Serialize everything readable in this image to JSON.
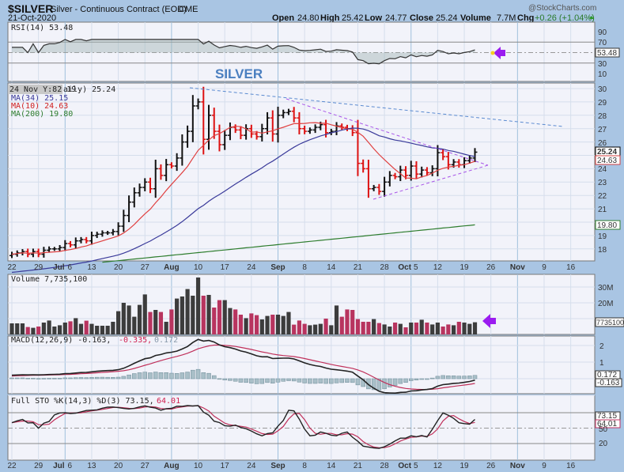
{
  "header": {
    "symbol": "$SILVER",
    "name": "Silver - Continuous Contract (EOD)",
    "exchange": "CME",
    "date": "21-Oct-2020",
    "watermark": "@StockCharts.com",
    "open_label": "Open",
    "open": "24.80",
    "high_label": "High",
    "high": "25.42",
    "low_label": "Low",
    "low": "24.77",
    "close_label": "Close",
    "close": "25.24",
    "volume_label": "Volume",
    "volume": "7.7M",
    "chg_label": "Chg",
    "chg": "+0.26 (+1.04%)"
  },
  "annotation": {
    "title": "SILVER"
  },
  "panels": {
    "rsi": {
      "legend": "RSI(14) 53.48",
      "value": "53.48",
      "ticks": [
        "90",
        "70",
        "30",
        "10"
      ]
    },
    "price": {
      "legend": "aily) 25.24",
      "tooltip": "24 Nov Y:82 19",
      "ma34": "MA(34) 25.15",
      "ma10": "MA(10) 24.63",
      "ma200": "MA(200) 19.80",
      "close_tag": "25.24",
      "ma10_tag": "24.63",
      "ma200_tag": "19.80",
      "ticks": [
        "30",
        "29",
        "28",
        "27",
        "26",
        "24",
        "23",
        "22",
        "21",
        "19",
        "18"
      ]
    },
    "volume": {
      "legend": "Volume 7,735,100",
      "tag": "7735100",
      "ticks": [
        "30M",
        "20M"
      ]
    },
    "macd": {
      "legend_name": "MACD(12,26,9) -0.163,",
      "legend_signal": "-0.335,",
      "legend_hist": "0.172",
      "hist_tag": "0.172",
      "macd_tag": "-0.163",
      "ticks": [
        "2",
        "1"
      ]
    },
    "sto": {
      "legend_name": "Full STO %K(14,3) %D(3) 73.15,",
      "legend_d": "64.01",
      "k_tag": "73.15",
      "d_tag": "64.01",
      "ticks": [
        "50",
        "20"
      ]
    }
  },
  "colors": {
    "up": "#111111",
    "down": "#dd1111",
    "ma10": "#e04040",
    "ma34": "#3a3a9a",
    "ma200": "#2e7d2e",
    "vol_up": "#3c3c3c",
    "vol_down": "#b8345f",
    "arrow": "#9b1cf0"
  },
  "date_labels": [
    {
      "i": 0,
      "text": "22"
    },
    {
      "i": 5,
      "text": "29"
    },
    {
      "i": 10,
      "text": "Jul",
      "sub": "6"
    },
    {
      "i": 15,
      "text": "13"
    },
    {
      "i": 20,
      "text": "20"
    },
    {
      "i": 25,
      "text": "27"
    },
    {
      "i": 30,
      "text": "Aug",
      "bold": true
    },
    {
      "i": 35,
      "text": "10"
    },
    {
      "i": 40,
      "text": "17"
    },
    {
      "i": 45,
      "text": "24"
    },
    {
      "i": 50,
      "text": "Sep",
      "bold": true
    },
    {
      "i": 55,
      "text": "8"
    },
    {
      "i": 60,
      "text": "14"
    },
    {
      "i": 65,
      "text": "21"
    },
    {
      "i": 70,
      "text": "28"
    },
    {
      "i": 75,
      "text": "Oct",
      "sub": "5"
    },
    {
      "i": 80,
      "text": "12"
    },
    {
      "i": 85,
      "text": "19"
    },
    {
      "i": 90,
      "text": "26"
    },
    {
      "i": 95,
      "text": "Nov",
      "bold": true
    },
    {
      "i": 100,
      "text": "9"
    },
    {
      "i": 105,
      "text": "16"
    }
  ],
  "chart_data": {
    "type": "ohlc",
    "title": "$SILVER Silver - Continuous Contract (EOD)",
    "x_start": "2020-06-22",
    "x_end": "2020-10-21",
    "closes": [
      17.6,
      17.7,
      17.8,
      17.6,
      17.8,
      17.6,
      17.9,
      18.0,
      18.0,
      18.1,
      18.4,
      18.3,
      18.6,
      18.7,
      18.6,
      19.0,
      19.1,
      19.2,
      19.2,
      19.3,
      19.7,
      20.5,
      21.5,
      22.2,
      22.6,
      23.0,
      22.5,
      24.0,
      23.5,
      24.3,
      24.2,
      24.8,
      26.0,
      26.8,
      28.7,
      29.0,
      26.2,
      28.0,
      26.8,
      25.8,
      26.5,
      27.1,
      26.9,
      26.5,
      27.0,
      26.6,
      26.4,
      27.0,
      27.8,
      26.6,
      28.0,
      28.2,
      28.3,
      27.8,
      27.0,
      26.8,
      26.9,
      27.1,
      27.3,
      26.7,
      26.8,
      27.2,
      27.1,
      27.0,
      26.7,
      24.4,
      24.0,
      22.5,
      22.6,
      22.3,
      23.0,
      23.5,
      23.4,
      23.9,
      23.5,
      24.2,
      23.6,
      23.9,
      23.7,
      24.0,
      25.2,
      24.9,
      24.3,
      24.5,
      24.3,
      24.6,
      24.8,
      25.24
    ],
    "volume_millions": [
      7.0,
      7.0,
      7.0,
      4.7,
      4.2,
      5.0,
      7.5,
      8.8,
      5.0,
      5.8,
      7.5,
      8.3,
      10.3,
      6.7,
      8.7,
      6.7,
      5.5,
      5.5,
      5.5,
      8.0,
      14.7,
      20.0,
      18.3,
      11.2,
      18.7,
      25.3,
      14.2,
      15.5,
      14.2,
      8.0,
      15.8,
      22.7,
      24.0,
      28.7,
      24.5,
      36.0,
      24.5,
      25.0,
      17.0,
      21.7,
      21.7,
      16.7,
      15.8,
      12.5,
      10.3,
      13.3,
      12.2,
      9.5,
      11.7,
      12.5,
      12.5,
      11.7,
      14.2,
      6.2,
      8.8,
      6.7,
      5.8,
      6.2,
      6.7,
      10.0,
      5.8,
      18.3,
      11.2,
      15.8,
      15.5,
      9.7,
      8.0,
      8.0,
      9.7,
      7.2,
      6.3,
      5.0,
      7.5,
      6.7,
      4.5,
      7.5,
      7.5,
      9.3,
      7.5,
      6.3,
      7.5,
      5.0,
      6.3,
      5.8,
      8.0,
      7.5,
      6.7,
      7.7
    ],
    "ma200_range": [
      17.0,
      19.8
    ],
    "price_ylim": [
      17.5,
      30.5
    ],
    "rsi_levels": [
      30,
      70
    ]
  }
}
